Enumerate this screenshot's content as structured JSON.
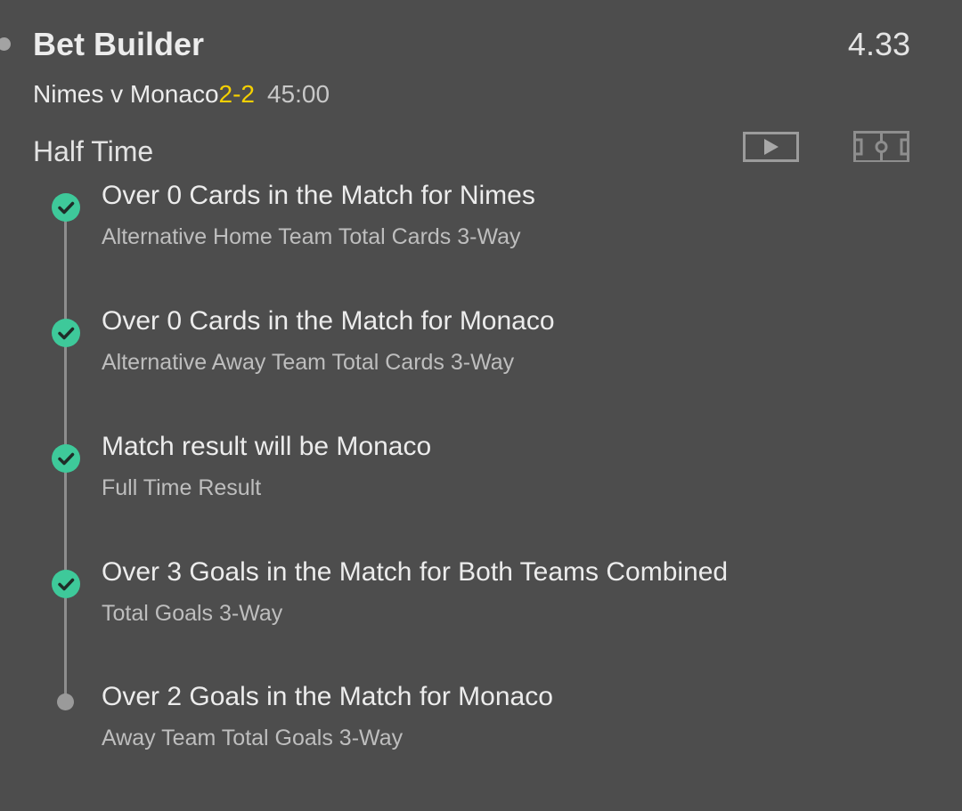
{
  "bet": {
    "title": "Bet Builder",
    "odds": "4.33",
    "match": "Nimes v Monaco",
    "score": "2-2",
    "clock": "45:00",
    "period": "Half Time"
  },
  "icons": {
    "video": "play-video-icon",
    "pitch": "football-pitch-icon",
    "check": "check-icon"
  },
  "colors": {
    "background": "#4d4d4d",
    "score": "#f5d000",
    "won": "#3ec99a",
    "pending": "#9a9a9a"
  },
  "selections": [
    {
      "name": "Over 0 Cards in the Match for Nimes",
      "market": "Alternative Home Team Total Cards 3-Way",
      "status": "won"
    },
    {
      "name": "Over 0 Cards in the Match for Monaco",
      "market": "Alternative Away Team Total Cards 3-Way",
      "status": "won"
    },
    {
      "name": "Match result will be Monaco",
      "market": "Full Time Result",
      "status": "won"
    },
    {
      "name": "Over 3 Goals in the Match for Both Teams Combined",
      "market": "Total Goals 3-Way",
      "status": "won"
    },
    {
      "name": "Over 2 Goals in the Match for Monaco",
      "market": "Away Team Total Goals 3-Way",
      "status": "pending"
    }
  ]
}
